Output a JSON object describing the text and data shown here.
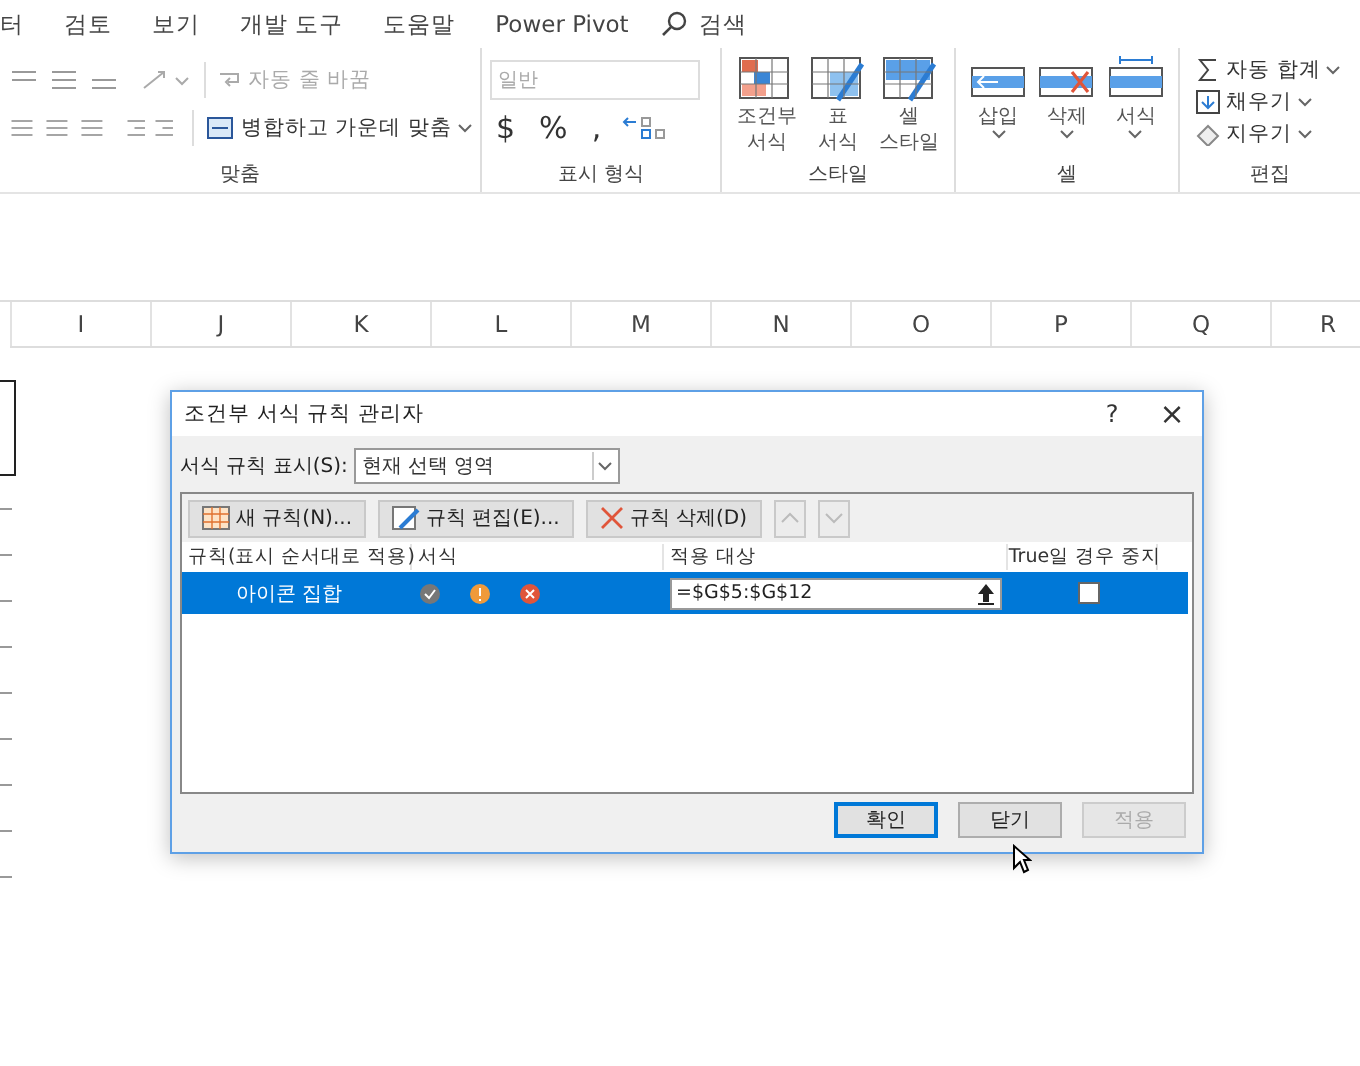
{
  "menu_tabs": [
    {
      "label": "터"
    },
    {
      "label": "검토"
    },
    {
      "label": "보기"
    },
    {
      "label": "개발 도구"
    },
    {
      "label": "도움말"
    },
    {
      "label": "Power Pivot"
    }
  ],
  "search": {
    "label": "검색"
  },
  "ribbon": {
    "alignment": {
      "wrap_text": "자동 줄 바꿈",
      "merge_center": "병합하고 가운데 맞춤",
      "group_label": "맞춤"
    },
    "number": {
      "format": "일반",
      "currency": "$",
      "percent": "%",
      "comma": ",",
      "group_label": "표시 형식"
    },
    "styles": {
      "buttons": [
        {
          "kind": "conditional",
          "lines": [
            "조건부",
            "서식"
          ]
        },
        {
          "kind": "table",
          "lines": [
            "표",
            "서식"
          ]
        },
        {
          "kind": "cell",
          "lines": [
            "셀",
            "스타일"
          ]
        }
      ],
      "group_label": "스타일"
    },
    "cells": {
      "buttons": [
        {
          "kind": "insert",
          "label": "삽입"
        },
        {
          "kind": "delete",
          "label": "삭제"
        },
        {
          "kind": "format",
          "label": "서식"
        }
      ],
      "group_label": "셀"
    },
    "editing": {
      "items": [
        {
          "kind": "sum",
          "label": "자동 합계"
        },
        {
          "kind": "fill",
          "label": "채우기"
        },
        {
          "kind": "clear",
          "label": "지우기"
        }
      ],
      "group_label": "편집"
    }
  },
  "columns": [
    "I",
    "J",
    "K",
    "L",
    "M",
    "N",
    "O",
    "P",
    "Q",
    "R"
  ],
  "dialog": {
    "title": "조건부 서식 규칙 관리자",
    "help": "?",
    "close": "×",
    "show_label": "서식 규칙 표시(S):",
    "show_value": "현재 선택 영역",
    "toolbar": [
      {
        "kind": "new",
        "label": "새 규칙(N)..."
      },
      {
        "kind": "edit",
        "label": "규칙 편집(E)..."
      },
      {
        "kind": "delete",
        "label": "규칙 삭제(D)"
      }
    ],
    "move_up_disabled": true,
    "move_down_disabled": true,
    "columns": [
      "규칙(표시 순서대로 적용)",
      "서식",
      "적용 대상",
      "True일 경우 중지"
    ],
    "rules": [
      {
        "name": "아이콘 집합",
        "applies_to": "=$G$5:$G$12",
        "stop_if_true": false,
        "selected": true
      }
    ],
    "buttons": [
      {
        "label": "확인",
        "default": true,
        "disabled": false
      },
      {
        "label": "닫기",
        "default": false,
        "disabled": false
      },
      {
        "label": "적용",
        "default": false,
        "disabled": true
      }
    ]
  }
}
